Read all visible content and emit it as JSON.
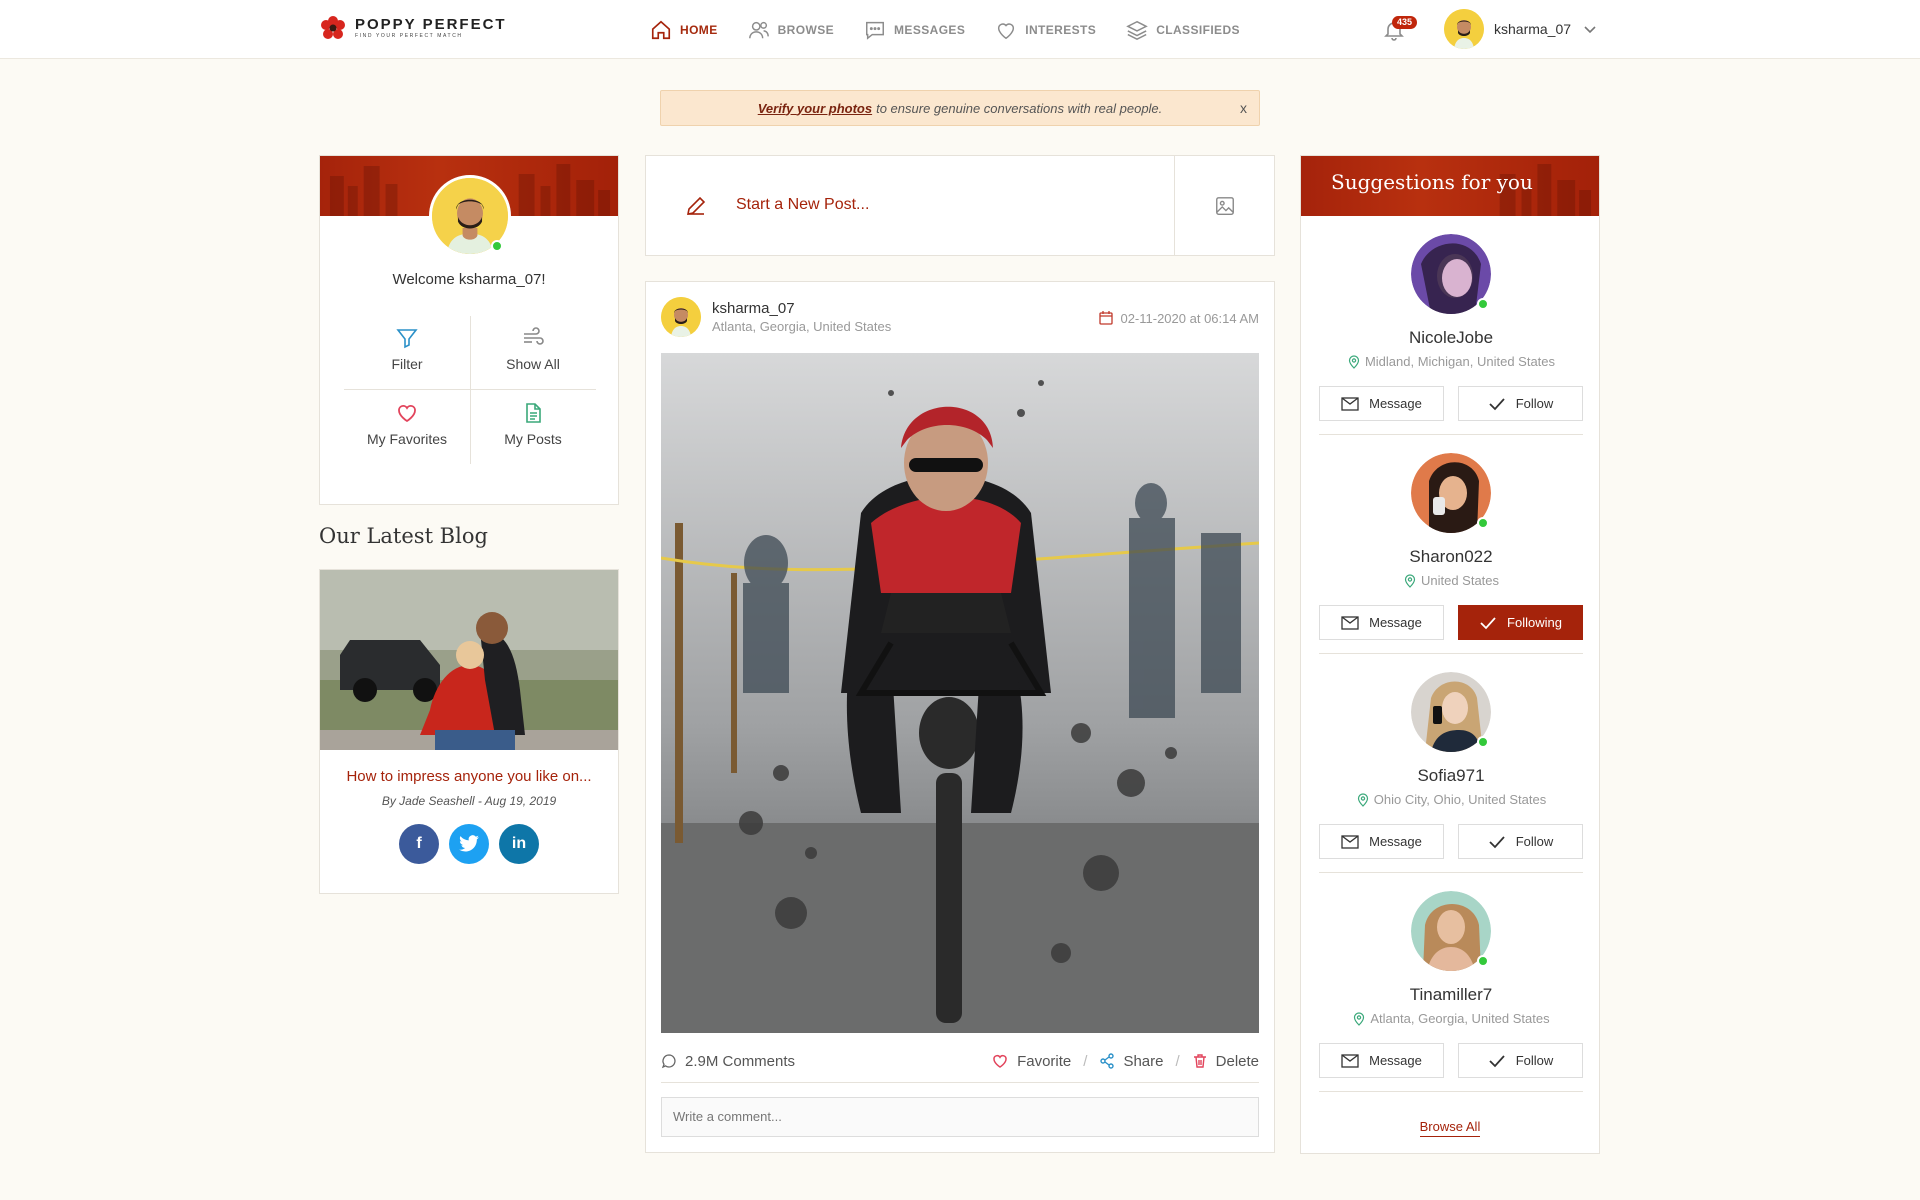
{
  "brand": {
    "name": "POPPY PERFECT",
    "tagline": "FIND YOUR PERFECT MATCH",
    "accent": "#a5230b"
  },
  "nav": {
    "home": "HOME",
    "browse": "BROWSE",
    "messages": "MESSAGES",
    "interests": "INTERESTS",
    "classifieds": "CLASSIFIEDS"
  },
  "header": {
    "notification_count": "435",
    "username": "ksharma_07"
  },
  "notice": {
    "link": "Verify your photos",
    "text": "to ensure genuine conversations with real people.",
    "close": "x"
  },
  "profile": {
    "welcome": "Welcome ksharma_07!",
    "actions": {
      "filter": "Filter",
      "show_all": "Show All",
      "favorites": "My Favorites",
      "posts": "My Posts"
    }
  },
  "blog": {
    "heading": "Our Latest Blog",
    "title": "How to impress anyone you like on...",
    "meta": "By Jade Seashell - Aug 19, 2019",
    "social": {
      "facebook": "f",
      "linkedin": "in"
    }
  },
  "new_post": {
    "label": "Start a New Post..."
  },
  "post": {
    "username": "ksharma_07",
    "location": "Atlanta, Georgia, United States",
    "date": "02-11-2020 at 06:14 AM",
    "comments": "2.9M Comments",
    "favorite": "Favorite",
    "share": "Share",
    "delete": "Delete",
    "comment_placeholder": "Write a comment..."
  },
  "suggestions": {
    "title": "Suggestions for you",
    "message_label": "Message",
    "browse_all": "Browse All",
    "items": [
      {
        "name": "NicoleJobe",
        "location": "Midland, Michigan, United States",
        "follow": "Follow"
      },
      {
        "name": "Sharon022",
        "location": "United States",
        "follow": "Following"
      },
      {
        "name": "Sofia971",
        "location": "Ohio City, Ohio, United States",
        "follow": "Follow"
      },
      {
        "name": "Tinamiller7",
        "location": "Atlanta, Georgia, United States",
        "follow": "Follow"
      }
    ]
  }
}
